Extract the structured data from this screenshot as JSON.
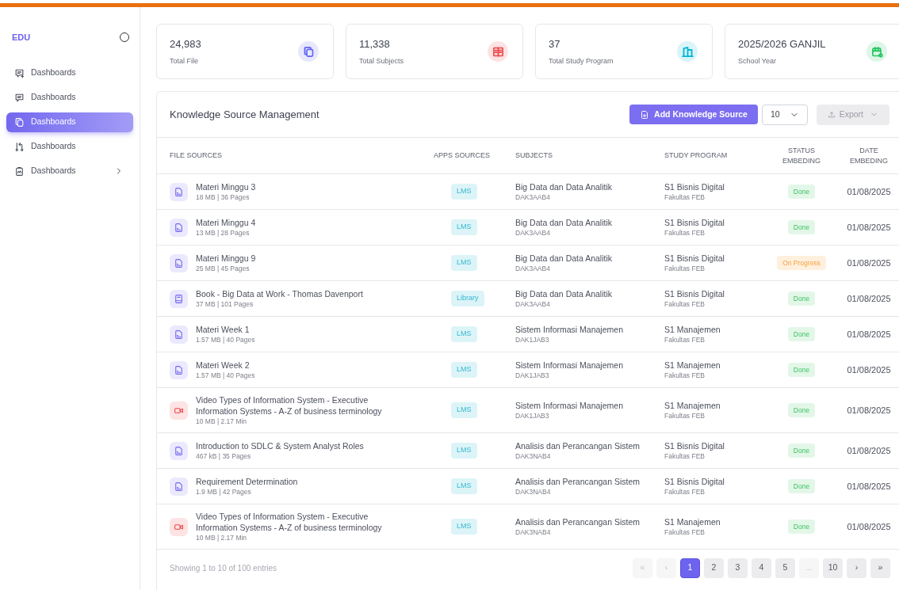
{
  "brand": "EDU",
  "sidebar": {
    "items": [
      {
        "label": "Dashboards",
        "kind": "chat-plus",
        "selected": false,
        "has_submenu": false
      },
      {
        "label": "Dashboards",
        "kind": "chat",
        "selected": false,
        "has_submenu": false
      },
      {
        "label": "Dashboards",
        "kind": "files",
        "selected": true,
        "has_submenu": false
      },
      {
        "label": "Dashboards",
        "kind": "git",
        "selected": false,
        "has_submenu": false
      },
      {
        "label": "Dashboards",
        "kind": "clipboard",
        "selected": false,
        "has_submenu": true
      }
    ]
  },
  "stats": [
    {
      "value": "24,983",
      "label": "Total File",
      "kind": "files",
      "color": "#6366f1"
    },
    {
      "value": "11,338",
      "label": "Total Subjects",
      "kind": "book",
      "color": "#ef4444"
    },
    {
      "value": "37",
      "label": "Total Study Program",
      "kind": "building",
      "color": "#06b6d4"
    },
    {
      "value": "2025/2026 GANJIL",
      "label": "School Year",
      "kind": "calendar",
      "color": "#22c55e"
    }
  ],
  "table": {
    "title": "Knowledge Source Management",
    "add_button": "Add Knowledge Source",
    "page_size": "10",
    "export_button": "Export",
    "columns": [
      "FILE SOURCES",
      "APPS SOURCES",
      "SUBJECTS",
      "STUDY PROGRAM",
      "STATUS EMBEDING",
      "DATE EMBEDING"
    ],
    "rows": [
      {
        "kind": "pdf",
        "title": "Materi Minggu 3",
        "meta": "18 MB | 36 Pages",
        "app": "LMS",
        "subject": "Big Data dan Data Analitik",
        "code": "DAK3AAB4",
        "program": "S1 Bisnis Digital",
        "faculty": "Fakultas FEB",
        "status": {
          "kind": "done",
          "label": "Done"
        },
        "date": "01/08/2025"
      },
      {
        "kind": "pdf",
        "title": "Materi Minggu 4",
        "meta": "13 MB | 28 Pages",
        "app": "LMS",
        "subject": "Big Data dan Data Analitik",
        "code": "DAK3AAB4",
        "program": "S1 Bisnis Digital",
        "faculty": "Fakultas FEB",
        "status": {
          "kind": "done",
          "label": "Done"
        },
        "date": "01/08/2025"
      },
      {
        "kind": "pdf",
        "title": "Materi Minggu 9",
        "meta": "25 MB | 45 Pages",
        "app": "LMS",
        "subject": "Big Data dan Data Analitik",
        "code": "DAK3AAB4",
        "program": "S1 Bisnis Digital",
        "faculty": "Fakultas FEB",
        "status": {
          "kind": "progress",
          "label": "On Progress"
        },
        "date": "01/08/2025"
      },
      {
        "kind": "book",
        "title": "Book - Big Data at Work - Thomas Davenport",
        "meta": "37 MB | 101 Pages",
        "app": "Library",
        "subject": "Big Data dan Data Analitik",
        "code": "DAK3AAB4",
        "program": "S1 Bisnis Digital",
        "faculty": "Fakultas FEB",
        "status": {
          "kind": "done",
          "label": "Done"
        },
        "date": "01/08/2025"
      },
      {
        "kind": "pdf",
        "title": "Materi Week 1",
        "meta": "1.57 MB | 40 Pages",
        "app": "LMS",
        "subject": "Sistem Informasi Manajemen",
        "code": "DAK1JAB3",
        "program": "S1 Manajemen",
        "faculty": "Fakultas FEB",
        "status": {
          "kind": "done",
          "label": "Done"
        },
        "date": "01/08/2025"
      },
      {
        "kind": "pdf",
        "title": "Materi Week 2",
        "meta": "1.57 MB | 40 Pages",
        "app": "LMS",
        "subject": "Sistem Informasi Manajemen",
        "code": "DAK1JAB3",
        "program": "S1 Manajemen",
        "faculty": "Fakultas FEB",
        "status": {
          "kind": "done",
          "label": "Done"
        },
        "date": "01/08/2025"
      },
      {
        "kind": "video",
        "title": "Video Types of Information System - Executive Information Systems - A-Z of business terminology",
        "meta": "10 MB | 2.17 Min",
        "app": "LMS",
        "subject": "Sistem Informasi Manajemen",
        "code": "DAK1JAB3",
        "program": "S1 Manajemen",
        "faculty": "Fakultas FEB",
        "status": {
          "kind": "done",
          "label": "Done"
        },
        "date": "01/08/2025"
      },
      {
        "kind": "pdf",
        "title": "Introduction to SDLC & System Analyst Roles",
        "meta": "467 kB | 35 Pages",
        "app": "LMS",
        "subject": "Analisis dan Perancangan Sistem",
        "code": "DAK3NAB4",
        "program": "S1 Bisnis Digital",
        "faculty": "Fakultas FEB",
        "status": {
          "kind": "done",
          "label": "Done"
        },
        "date": "01/08/2025"
      },
      {
        "kind": "pdf",
        "title": "Requirement Determination",
        "meta": "1.9 MB | 42 Pages",
        "app": "LMS",
        "subject": "Analisis dan Perancangan Sistem",
        "code": "DAK3NAB4",
        "program": "S1 Bisnis Digital",
        "faculty": "Fakultas FEB",
        "status": {
          "kind": "done",
          "label": "Done"
        },
        "date": "01/08/2025"
      },
      {
        "kind": "video",
        "title": "Video Types of Information System - Executive Information Systems - A-Z of business terminology",
        "meta": "10 MB | 2.17 Min",
        "app": "LMS",
        "subject": "Analisis dan Perancangan Sistem",
        "code": "DAK3NAB4",
        "program": "S1 Manajemen",
        "faculty": "Fakultas FEB",
        "status": {
          "kind": "done",
          "label": "Done"
        },
        "date": "01/08/2025"
      }
    ],
    "footer": "Showing 1 to 10 of 100 entries",
    "pagination": [
      {
        "label": "«",
        "selected": false,
        "disabled": true
      },
      {
        "label": "‹",
        "selected": false,
        "disabled": true
      },
      {
        "label": "1",
        "selected": true,
        "disabled": false
      },
      {
        "label": "2",
        "selected": false,
        "disabled": false
      },
      {
        "label": "3",
        "selected": false,
        "disabled": false
      },
      {
        "label": "4",
        "selected": false,
        "disabled": false
      },
      {
        "label": "5",
        "selected": false,
        "disabled": false
      },
      {
        "label": "...",
        "selected": false,
        "disabled": true
      },
      {
        "label": "10",
        "selected": false,
        "disabled": false
      },
      {
        "label": "›",
        "selected": false,
        "disabled": false
      },
      {
        "label": "»",
        "selected": false,
        "disabled": false
      }
    ]
  }
}
